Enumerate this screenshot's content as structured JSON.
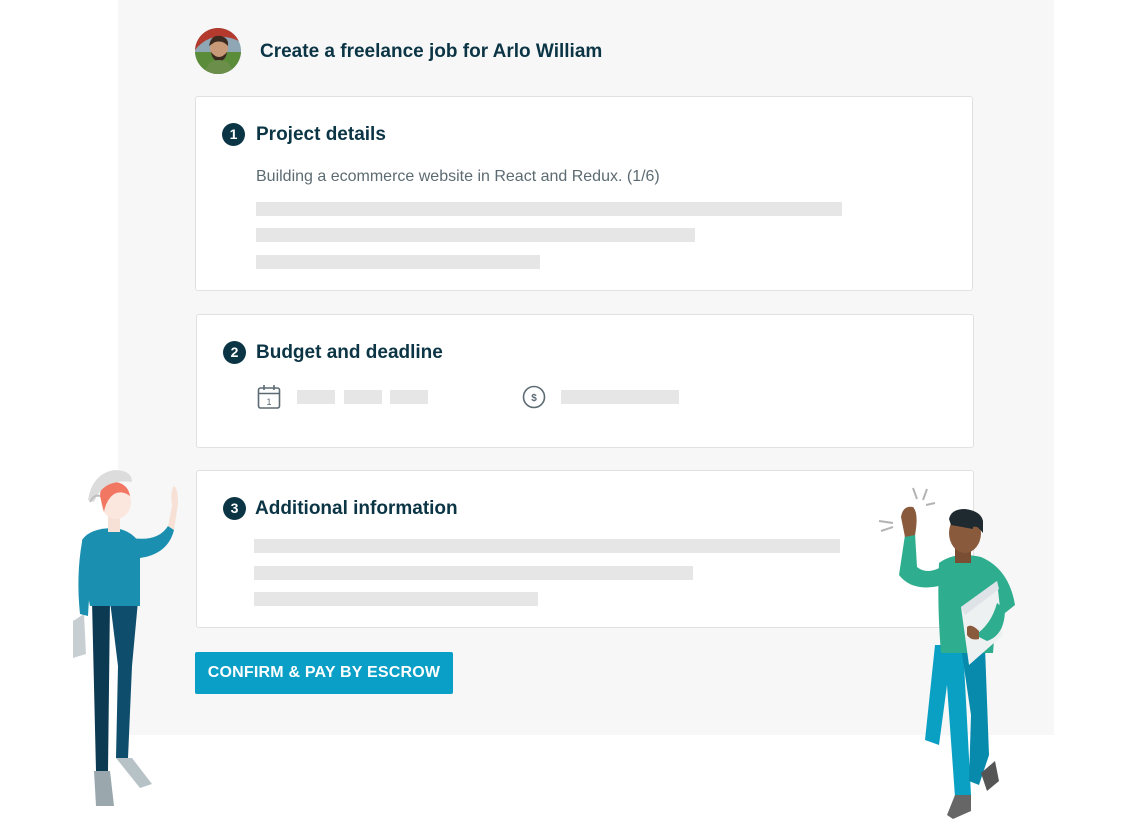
{
  "header": {
    "title": "Create a freelance job for Arlo William"
  },
  "sections": [
    {
      "number": "1",
      "title": "Project details",
      "description": "Building a ecommerce website in React and Redux. (1/6)"
    },
    {
      "number": "2",
      "title": "Budget and deadline",
      "calendar_day": "1",
      "currency_symbol": "$"
    },
    {
      "number": "3",
      "title": "Additional information"
    }
  ],
  "actions": {
    "confirm_label": "CONFIRM & PAY BY ESCROW"
  },
  "colors": {
    "primary": "#0a9fc6",
    "heading": "#0b3545",
    "placeholder": "#e6e6e6",
    "panel": "#f7f7f7"
  },
  "icons": [
    "avatar",
    "calendar-icon",
    "dollar-coin-icon",
    "woman-waving-illustration",
    "man-snapping-illustration"
  ]
}
